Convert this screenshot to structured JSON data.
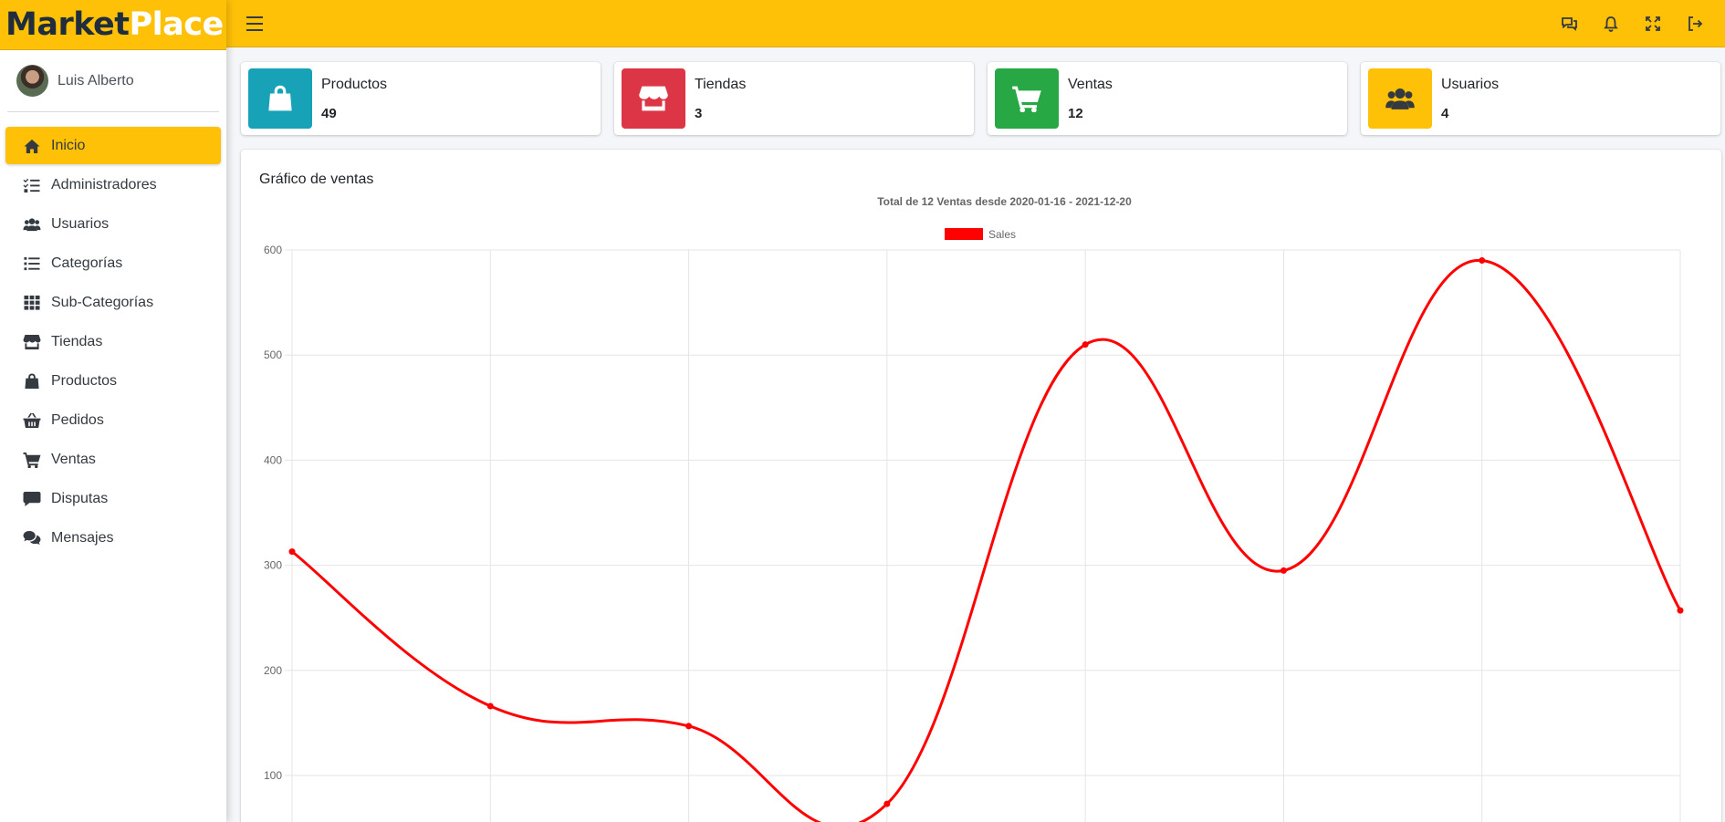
{
  "brand": {
    "part1": "Market",
    "part2": "Place"
  },
  "user": {
    "name": "Luis Alberto"
  },
  "nav": [
    {
      "label": "Inicio",
      "icon": "home-icon",
      "active": true
    },
    {
      "label": "Administradores",
      "icon": "list-check-icon"
    },
    {
      "label": "Usuarios",
      "icon": "users-icon"
    },
    {
      "label": "Categorías",
      "icon": "list-icon"
    },
    {
      "label": "Sub-Categorías",
      "icon": "grid-icon"
    },
    {
      "label": "Tiendas",
      "icon": "store-icon"
    },
    {
      "label": "Productos",
      "icon": "shopping-bag-icon"
    },
    {
      "label": "Pedidos",
      "icon": "basket-icon"
    },
    {
      "label": "Ventas",
      "icon": "cart-icon"
    },
    {
      "label": "Disputas",
      "icon": "comment-icon"
    },
    {
      "label": "Mensajes",
      "icon": "comments-icon"
    }
  ],
  "topbar": {
    "icons": [
      "chat-icon",
      "bell-icon",
      "expand-icon",
      "logout-icon"
    ]
  },
  "cards": [
    {
      "label": "Productos",
      "value": "49",
      "color": "#17a2b8",
      "icon": "shopping-bag-icon"
    },
    {
      "label": "Tiendas",
      "value": "3",
      "color": "#dc3545",
      "icon": "store-icon"
    },
    {
      "label": "Ventas",
      "value": "12",
      "color": "#28a745",
      "icon": "cart-icon"
    },
    {
      "label": "Usuarios",
      "value": "4",
      "color": "#ffc107",
      "icon": "users-icon"
    }
  ],
  "panel": {
    "title": "Gráfico de ventas"
  },
  "chart_data": {
    "type": "line",
    "title": "Total de 12 Ventas desde 2020-01-16 - 2021-12-20",
    "series": [
      {
        "name": "Sales",
        "color": "#ff0000",
        "values": [
          313,
          166,
          147,
          73,
          510,
          295,
          590,
          257
        ]
      }
    ],
    "yticks": [
      100,
      200,
      300,
      400,
      500,
      600
    ],
    "ylim_visible": [
      58,
      600
    ],
    "grid": true,
    "legend_position": "top-center",
    "curve": "smooth"
  }
}
